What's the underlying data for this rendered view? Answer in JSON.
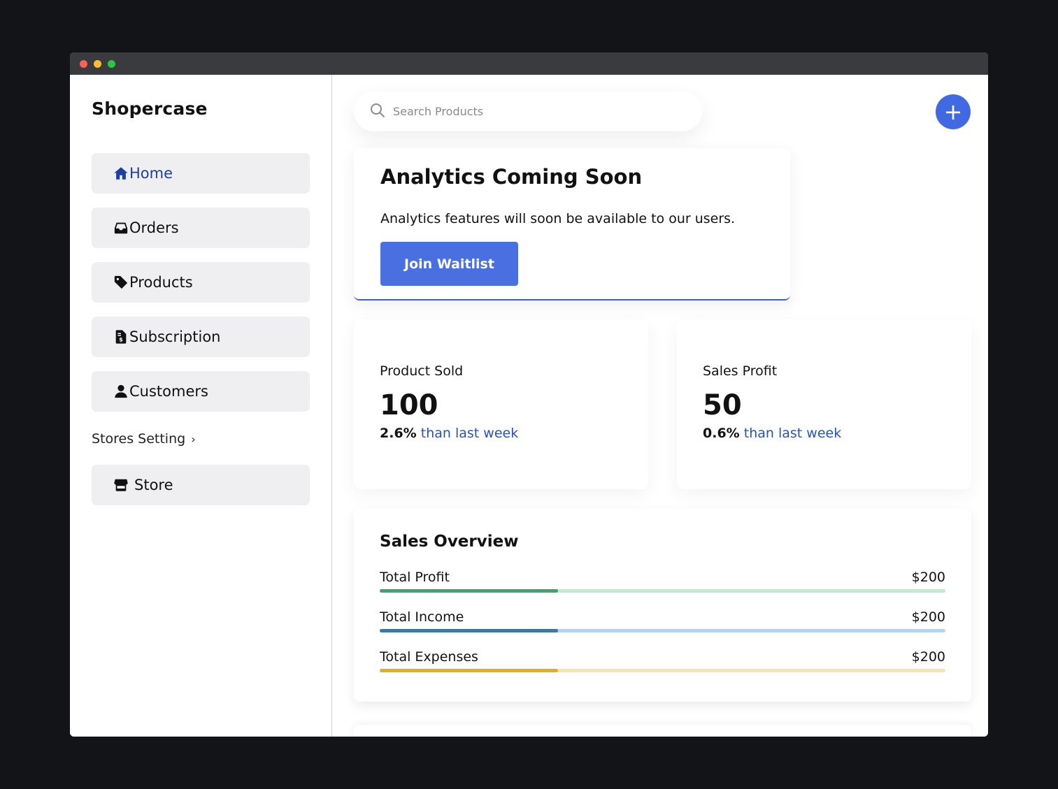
{
  "app": {
    "brand": "Shopercase"
  },
  "sidebar": {
    "items": [
      {
        "label": "Home",
        "icon": "home-icon",
        "active": true
      },
      {
        "label": "Orders",
        "icon": "inbox-icon"
      },
      {
        "label": "Products",
        "icon": "tag-icon"
      },
      {
        "label": "Subscription",
        "icon": "invoice-icon"
      },
      {
        "label": "Customers",
        "icon": "user-icon"
      }
    ],
    "section_label": "Stores Setting",
    "section_items": [
      {
        "label": "Store",
        "icon": "store-icon"
      }
    ]
  },
  "search": {
    "placeholder": "Search Products",
    "value": ""
  },
  "fab": {
    "label": "+",
    "icon": "plus-icon"
  },
  "analytics": {
    "title": "Analytics Coming Soon",
    "description": "Analytics features will soon be available to our users.",
    "button_label": "Join Waitlist"
  },
  "stats": [
    {
      "label": "Product Sold",
      "value": "100",
      "change": "2.6%",
      "comparison": "than last week"
    },
    {
      "label": "Sales Profit",
      "value": "50",
      "change": "0.6%",
      "comparison": "than last week"
    }
  ],
  "sales_overview": {
    "title": "Sales Overview",
    "rows": [
      {
        "name": "Total Profit",
        "amount": "$200",
        "progress": 0.315,
        "color": "#3aa76d",
        "track_color": "#b7f0cf"
      },
      {
        "name": "Total Income",
        "amount": "$200",
        "progress": 0.315,
        "color": "#3b78a8",
        "track_color": "#b5d3f0"
      },
      {
        "name": "Total Expenses",
        "amount": "$200",
        "progress": 0.315,
        "color": "#e9ac1b",
        "track_color": "#f6e6a8"
      }
    ]
  },
  "colors": {
    "accent": "#4169e1",
    "active_nav": "#1f3fa0",
    "link": "#2753b8",
    "nav_bg": "#efeff2"
  }
}
